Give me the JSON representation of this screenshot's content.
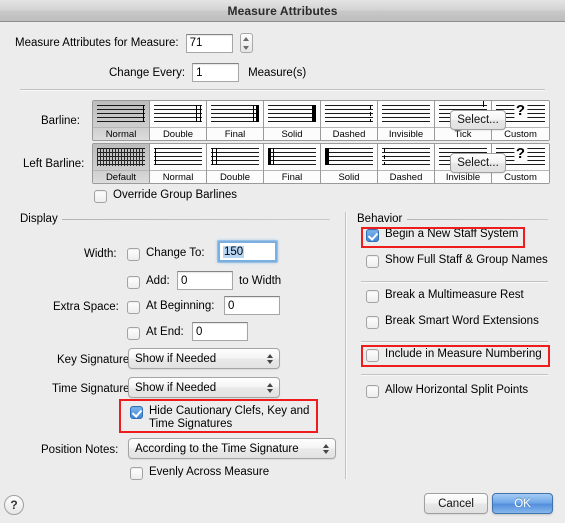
{
  "window": {
    "title": "Measure Attributes"
  },
  "top": {
    "measure_label": "Measure Attributes for Measure:",
    "measure_value": "71",
    "change_every_label": "Change Every:",
    "change_every_value": "1",
    "measures_suffix": "Measure(s)"
  },
  "barline": {
    "label": "Barline:",
    "select_label": "Select...",
    "selected_index": 0,
    "options": [
      {
        "caption": "Normal",
        "icon": "barline-normal-icon"
      },
      {
        "caption": "Double",
        "icon": "barline-double-icon"
      },
      {
        "caption": "Final",
        "icon": "barline-final-icon"
      },
      {
        "caption": "Solid",
        "icon": "barline-solid-icon"
      },
      {
        "caption": "Dashed",
        "icon": "barline-dashed-icon"
      },
      {
        "caption": "Invisible",
        "icon": "barline-invisible-icon"
      },
      {
        "caption": "Tick",
        "icon": "barline-tick-icon"
      },
      {
        "caption": "Custom",
        "icon": "barline-custom-icon"
      }
    ]
  },
  "left_barline": {
    "label": "Left Barline:",
    "select_label": "Select...",
    "selected_index": 0,
    "options": [
      {
        "caption": "Default",
        "icon": "left-barline-default-icon"
      },
      {
        "caption": "Normal",
        "icon": "left-barline-normal-icon"
      },
      {
        "caption": "Double",
        "icon": "left-barline-double-icon"
      },
      {
        "caption": "Final",
        "icon": "left-barline-final-icon"
      },
      {
        "caption": "Solid",
        "icon": "left-barline-solid-icon"
      },
      {
        "caption": "Dashed",
        "icon": "left-barline-dashed-icon"
      },
      {
        "caption": "Invisible",
        "icon": "left-barline-invisible-icon"
      },
      {
        "caption": "Custom",
        "icon": "left-barline-custom-icon"
      }
    ]
  },
  "override_group_barlines": {
    "label": "Override Group Barlines",
    "checked": false
  },
  "display": {
    "group_label": "Display",
    "width_label": "Width:",
    "change_to_label": "Change To:",
    "change_to_checked": false,
    "change_to_value": "150",
    "add_label": "Add:",
    "add_checked": false,
    "add_value": "0",
    "to_width_label": "to Width",
    "extra_space_label": "Extra Space:",
    "at_beginning_label": "At Beginning:",
    "at_beginning_checked": false,
    "at_beginning_value": "0",
    "at_end_label": "At End:",
    "at_end_checked": false,
    "at_end_value": "0",
    "key_signature_label": "Key Signature:",
    "key_signature_value": "Show if Needed",
    "time_signature_label": "Time Signature:",
    "time_signature_value": "Show if Needed",
    "hide_cautionary_label": "Hide Cautionary Clefs, Key and Time Signatures",
    "hide_cautionary_checked": true,
    "position_notes_label": "Position Notes:",
    "position_notes_value": "According to the Time Signature",
    "evenly_across_label": "Evenly Across Measure",
    "evenly_across_checked": false
  },
  "behavior": {
    "group_label": "Behavior",
    "items": [
      {
        "label": "Begin a New Staff System",
        "checked": true
      },
      {
        "label": "Show Full Staff & Group Names",
        "checked": false
      },
      {
        "label": "Break a Multimeasure Rest",
        "checked": false
      },
      {
        "label": "Break Smart Word Extensions",
        "checked": false
      },
      {
        "label": "Include in Measure Numbering",
        "checked": false
      },
      {
        "label": "Allow Horizontal Split Points",
        "checked": false
      }
    ]
  },
  "footer": {
    "help_label": "?",
    "cancel_label": "Cancel",
    "ok_label": "OK"
  },
  "colors": {
    "annotation": "#ee1c1c",
    "default_button": "#5a93dc",
    "checkbox_on": "#3f86d6",
    "background": "#ececec"
  }
}
